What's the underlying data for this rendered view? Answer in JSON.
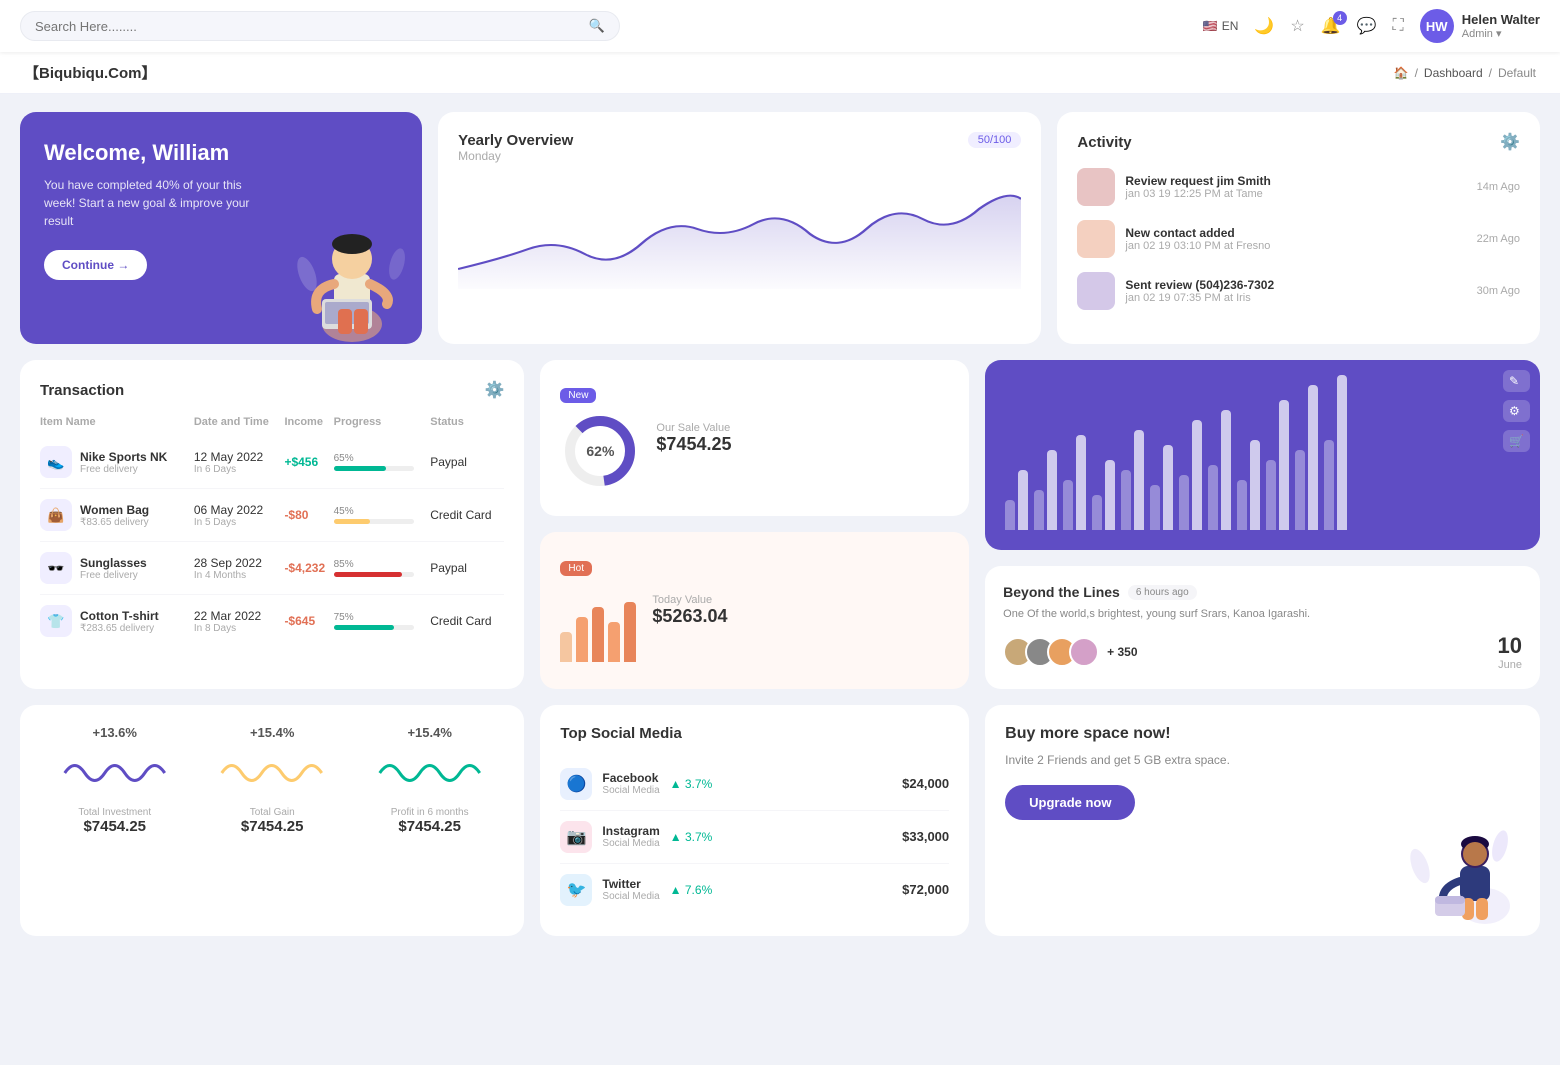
{
  "nav": {
    "search_placeholder": "Search Here........",
    "lang": "EN",
    "notification_count": "4",
    "user": {
      "name": "Helen Walter",
      "role": "Admin",
      "initials": "HW"
    }
  },
  "breadcrumb": {
    "brand": "【Biqubiqu.Com】",
    "home_label": "🏠",
    "dashboard": "Dashboard",
    "page": "Default"
  },
  "welcome": {
    "title": "Welcome, William",
    "subtitle": "You have completed 40% of your this week! Start a new goal & improve your result",
    "button": "Continue →"
  },
  "yearly": {
    "title": "Yearly Overview",
    "subtitle": "Monday",
    "badge": "50/100"
  },
  "activity": {
    "title": "Activity",
    "items": [
      {
        "title": "Review request jim Smith",
        "subtitle": "jan 03 19 12:25 PM at Tame",
        "time": "14m Ago",
        "color": "#e8c4c4"
      },
      {
        "title": "New contact added",
        "subtitle": "jan 02 19 03:10 PM at Fresno",
        "time": "22m Ago",
        "color": "#f4d0c0"
      },
      {
        "title": "Sent review (504)236-7302",
        "subtitle": "jan 02 19 07:35 PM at Iris",
        "time": "30m Ago",
        "color": "#d4c8e8"
      }
    ]
  },
  "transaction": {
    "title": "Transaction",
    "headers": [
      "Item Name",
      "Date and Time",
      "Income",
      "Progress",
      "Status"
    ],
    "rows": [
      {
        "icon": "👟",
        "name": "Nike Sports NK",
        "sub": "Free delivery",
        "date": "12 May 2022",
        "days": "In 6 Days",
        "income": "+$456",
        "income_type": "pos",
        "progress": 65,
        "progress_color": "#00b894",
        "status": "Paypal"
      },
      {
        "icon": "👜",
        "name": "Women Bag",
        "sub": "₹83.65 delivery",
        "date": "06 May 2022",
        "days": "In 5 Days",
        "income": "-$80",
        "income_type": "neg",
        "progress": 45,
        "progress_color": "#fdcb6e",
        "status": "Credit Card"
      },
      {
        "icon": "🕶️",
        "name": "Sunglasses",
        "sub": "Free delivery",
        "date": "28 Sep 2022",
        "days": "In 4 Months",
        "income": "-$4,232",
        "income_type": "neg",
        "progress": 85,
        "progress_color": "#d63031",
        "status": "Paypal"
      },
      {
        "icon": "👕",
        "name": "Cotton T-shirt",
        "sub": "₹283.65 delivery",
        "date": "22 Mar 2022",
        "days": "In 8 Days",
        "income": "-$645",
        "income_type": "neg",
        "progress": 75,
        "progress_color": "#00b894",
        "status": "Credit Card"
      }
    ]
  },
  "sale_new": {
    "badge": "New",
    "label": "Our Sale Value",
    "value": "$7454.25",
    "percent": "62%"
  },
  "sale_hot": {
    "badge": "Hot",
    "label": "Today Value",
    "value": "$5263.04"
  },
  "beyond": {
    "title": "Beyond the Lines",
    "time": "6 hours ago",
    "desc": "One Of the world,s brightest, young surf Srars, Kanoa Igarashi.",
    "plus_count": "+ 350",
    "date_num": "10",
    "date_month": "June"
  },
  "stats": {
    "items": [
      {
        "pct": "+13.6%",
        "label": "Total Investment",
        "value": "$7454.25",
        "color": "#5f4dc4"
      },
      {
        "pct": "+15.4%",
        "label": "Total Gain",
        "value": "$7454.25",
        "color": "#fdcb6e"
      },
      {
        "pct": "+15.4%",
        "label": "Profit in 6 months",
        "value": "$7454.25",
        "color": "#00b894"
      }
    ]
  },
  "social": {
    "title": "Top Social Media",
    "items": [
      {
        "name": "Facebook",
        "sub": "Social Media",
        "pct": "3.7%",
        "value": "$24,000",
        "color": "#1877f2",
        "icon": "f"
      },
      {
        "name": "Instagram",
        "sub": "Social Media",
        "pct": "3.7%",
        "value": "$33,000",
        "color": "#e1306c",
        "icon": "ig"
      },
      {
        "name": "Twitter",
        "sub": "Social Media",
        "pct": "7.6%",
        "value": "$72,000",
        "color": "#1da1f2",
        "icon": "tw"
      }
    ]
  },
  "upgrade": {
    "title": "Buy more space now!",
    "desc": "Invite 2 Friends and get 5 GB extra space.",
    "button": "Upgrade now"
  }
}
